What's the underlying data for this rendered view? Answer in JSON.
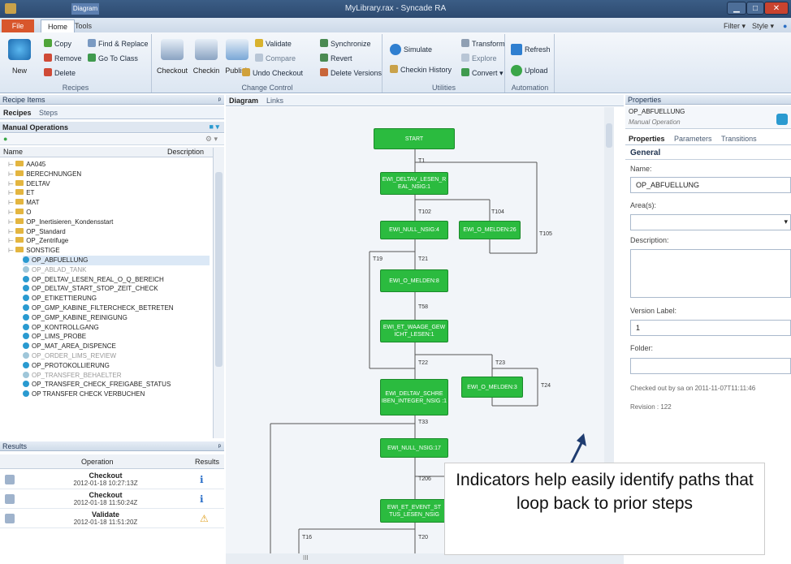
{
  "window": {
    "title": "MyLibrary.rax - Syncade RA",
    "context_tab": "Diagram"
  },
  "tabs": {
    "file": "File",
    "home": "Home",
    "tools": "Tools",
    "filter": "Filter",
    "style": "Style"
  },
  "ribbon": {
    "recipes": {
      "label": "Recipes",
      "new": "New",
      "copy": "Copy",
      "remove": "Remove",
      "delete": "Delete",
      "find_replace": "Find & Replace",
      "go_to_class": "Go To Class"
    },
    "change_control": {
      "label": "Change Control",
      "checkout": "Checkout",
      "checkin": "Checkin",
      "publish": "Publish",
      "validate": "Validate",
      "compare": "Compare",
      "undo_checkout": "Undo Checkout",
      "synchronize": "Synchronize",
      "revert": "Revert",
      "delete_versions": "Delete Versions"
    },
    "utilities": {
      "label": "Utilities",
      "simulate": "Simulate",
      "checkin_history": "Checkin History",
      "transform": "Transform",
      "explore": "Explore",
      "convert": "Convert"
    },
    "automation": {
      "label": "Automation",
      "refresh": "Refresh",
      "upload": "Upload"
    }
  },
  "recipe_items": {
    "header": "Recipe Items",
    "tab_recipes": "Recipes",
    "tab_steps": "Steps",
    "dropdown": "Manual Operations",
    "col_name": "Name",
    "col_description": "Description",
    "folders": [
      "AA045",
      "BERECHNUNGEN",
      "DELTAV",
      "ET",
      "MAT",
      "O",
      "OP_Inertisieren_Kondensstart",
      "OP_Standard",
      "OP_Zentrifuge",
      "SONSTIGE"
    ],
    "items": [
      "OP_ABFUELLUNG",
      "OP_ABLAD_TANK",
      "OP_DELTAV_LESEN_REAL_O_Q_BEREICH",
      "OP_DELTAV_START_STOP_ZEIT_CHECK",
      "OP_ETIKETTIERUNG",
      "OP_GMP_KABINE_FILTERCHECK_BETRETEN",
      "OP_GMP_KABINE_REINIGUNG",
      "OP_KONTROLLGANG",
      "OP_LIMS_PROBE",
      "OP_MAT_AREA_DISPENCE",
      "OP_ORDER_LIMS_REVIEW",
      "OP_PROTOKOLLIERUNG",
      "OP_TRANSFER_BEHAELTER",
      "OP_TRANSFER_CHECK_FREIGABE_STATUS",
      "OP TRANSFER CHECK VERBUCHEN"
    ]
  },
  "results": {
    "header": "Results",
    "col_operation": "Operation",
    "col_results": "Results",
    "rows": [
      {
        "op": "Checkout",
        "time": "2012-01-18 10:27:13Z"
      },
      {
        "op": "Checkout",
        "time": "2012-01-18 11:50:24Z"
      },
      {
        "op": "Validate",
        "time": "2012-01-18 11:51:20Z"
      }
    ]
  },
  "diagram": {
    "tab_diagram": "Diagram",
    "tab_links": "Links",
    "nodes": {
      "start": "START",
      "n1": "EWI_DELTAV_LESEN_R EAL_NSIG:1",
      "n4": "EWI_NULL_NSIG:4",
      "n26": "EWI_O_MELDEN:26",
      "n8": "EWI_O_MELDEN:8",
      "n_waage": "EWI_ET_WAAGE_GEW ICHT_LESEN:1",
      "n_schreib": "EWI_DELTAV_SCHRE IBEN_INTEGER_NSIG :1",
      "n3": "EWI_O_MELDEN:3",
      "n17": "EWI_NULL_NSIG:17",
      "n_event": "EWI_ET_EVENT_ST TUS_LESEN_NSIG"
    },
    "transitions": {
      "t1": "T1",
      "t102": "T102",
      "t104": "T104",
      "t105": "T105",
      "t19": "T19",
      "t21": "T21",
      "t58": "T58",
      "t22": "T22",
      "t23": "T23",
      "t24": "T24",
      "t33": "T33",
      "t206": "T206",
      "t16": "T16",
      "t20": "T20"
    },
    "callout": "Indicators help easily identify paths that loop back to prior steps",
    "scroll_text": "III"
  },
  "properties": {
    "header": "Properties",
    "object_name": "OP_ABFUELLUNG",
    "object_type": "Manual Operation",
    "tab_properties": "Properties",
    "tab_parameters": "Parameters",
    "tab_transitions": "Transitions",
    "section": "General",
    "name_label": "Name:",
    "name_value": "OP_ABFUELLUNG",
    "area_label": "Area(s):",
    "description_label": "Description:",
    "version_label": "Version Label:",
    "version_value": "1",
    "folder_label": "Folder:",
    "checked_out": "Checked out by sa on 2011-11-07T11:11:46",
    "revision": "Revision : 122"
  }
}
